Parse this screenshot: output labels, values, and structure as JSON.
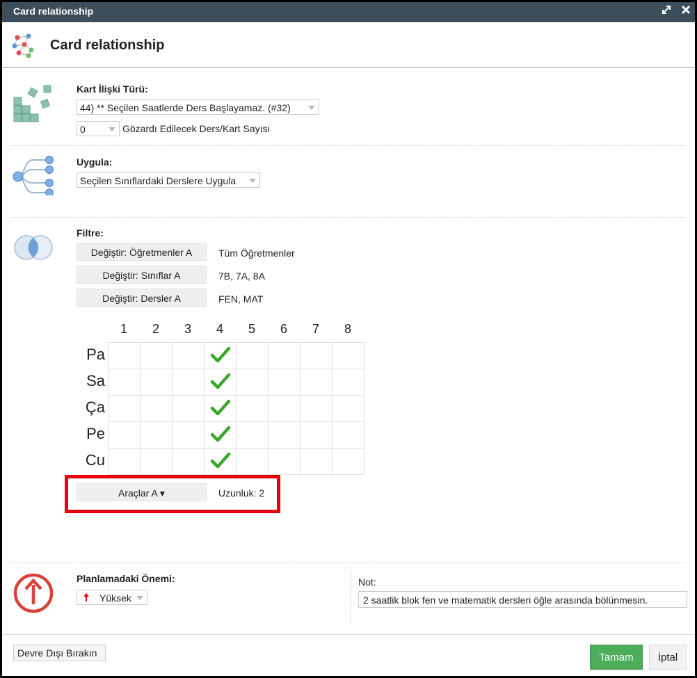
{
  "window": {
    "title": "Card relationship",
    "controls": [
      "expand-icon",
      "close-icon"
    ]
  },
  "header": {
    "title": "Card relationship",
    "icon": "network-icon"
  },
  "relation_type": {
    "label": "Kart İlişki Türü:",
    "selected": "44) ** Seçilen Saatlerde Ders Başlayamaz. (#32)",
    "ignore_count_value": "0",
    "ignore_count_label": "Gözardı Edilecek Ders/Kart Sayısı",
    "icon": "blocks-icon"
  },
  "apply": {
    "label": "Uygula:",
    "selected": "Seçilen Sınıflardaki Derslere Uygula",
    "icon": "tree-icon"
  },
  "filter": {
    "label": "Filtre:",
    "icon": "venn-icon",
    "rows": [
      {
        "button": "Değiştir: Öğretmenler A",
        "value": "Tüm Öğretmenler"
      },
      {
        "button": "Değiştir: Sınıflar A",
        "value": "7B, 7A, 8A"
      },
      {
        "button": "Değiştir: Dersler A",
        "value": "FEN, MAT"
      }
    ]
  },
  "timetable": {
    "columns": [
      "1",
      "2",
      "3",
      "4",
      "5",
      "6",
      "7",
      "8"
    ],
    "days": [
      "Pa",
      "Sa",
      "Ça",
      "Pe",
      "Cu"
    ],
    "checked": [
      [
        3
      ],
      [
        3
      ],
      [
        3
      ],
      [
        3
      ],
      [
        3
      ]
    ],
    "check_color": "#3aa62c"
  },
  "tools": {
    "button": "Araçlar A ▾",
    "length": "Uzunluk: 2",
    "highlight_color": "#e8000b"
  },
  "importance": {
    "label": "Planlamadaki Önemi:",
    "selected": "Yüksek",
    "icon": "arrow-up-circle-icon",
    "accent": "#d9423a"
  },
  "note": {
    "label": "Not:",
    "value": "2 saatlik blok fen ve matematik dersleri öğle arasında bölünmesin."
  },
  "footer": {
    "disable_label": "Devre Dışı Bırakın",
    "ok_label": "Tamam",
    "cancel_label": "İptal",
    "ok_color": "#4cae5b"
  }
}
